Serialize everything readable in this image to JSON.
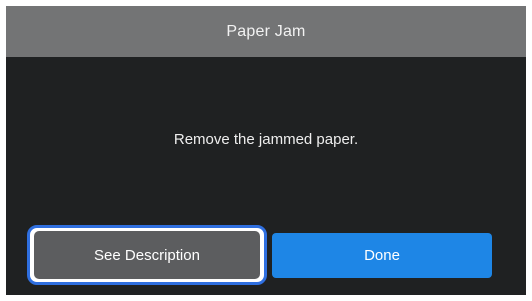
{
  "dialog": {
    "title": "Paper Jam",
    "message": "Remove the jammed paper."
  },
  "buttons": {
    "see_description": "See Description",
    "done": "Done"
  },
  "colors": {
    "titlebar_bg": "#737475",
    "panel_bg": "#1f2122",
    "secondary_button_bg": "#5c5d5f",
    "primary_button_bg": "#1e86e6",
    "focus_ring": "#2f6fe0"
  }
}
